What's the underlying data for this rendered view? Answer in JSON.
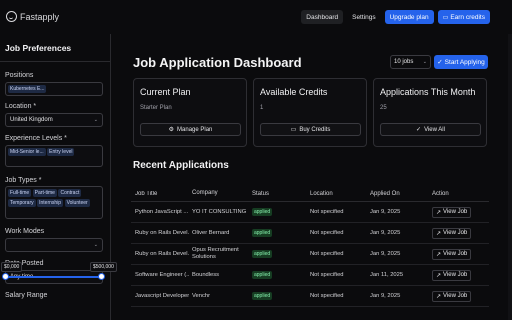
{
  "app": {
    "name": "Fastapply"
  },
  "nav": {
    "dashboard": "Dashboard",
    "settings": "Settings",
    "upgrade": "Upgrade plan",
    "earn": "Earn credits"
  },
  "sidebar": {
    "title": "Job Preferences",
    "positions": {
      "label": "Positions",
      "tags": [
        "Kubernetes E..."
      ]
    },
    "location": {
      "label": "Location *",
      "value": "United Kingdom"
    },
    "experience": {
      "label": "Experience Levels *",
      "tags": [
        "Mid-Senior le...",
        "Entry level"
      ]
    },
    "job_types": {
      "label": "Job Types *",
      "tags": [
        "Full-time",
        "Part-time",
        "Contract",
        "Temporary",
        "Internship",
        "Volunteer"
      ]
    },
    "work_modes": {
      "label": "Work Modes",
      "value": ""
    },
    "date_posted": {
      "label": "Date Posted",
      "value": "Any time"
    },
    "salary": {
      "label": "Salary Range",
      "min": "$0,000",
      "max": "$500,000",
      "min_frac": 0,
      "max_frac": 1
    }
  },
  "main": {
    "title": "Job Application Dashboard",
    "jobs_select": "10 jobs",
    "start_button": "Start Applying",
    "cards": [
      {
        "title": "Current Plan",
        "value": "Starter Plan",
        "button": "Manage Plan",
        "icon": "gear-icon"
      },
      {
        "title": "Available Credits",
        "value": "1",
        "button": "Buy Credits",
        "icon": "card-icon"
      },
      {
        "title": "Applications This Month",
        "value": "25",
        "button": "View All",
        "icon": "checkmark-icon"
      }
    ],
    "recent_title": "Recent Applications",
    "table": {
      "headers": [
        "Job Title",
        "Company",
        "Status",
        "Location",
        "Applied On",
        "Action"
      ],
      "rows": [
        {
          "title": "Python JavaScript ...",
          "company": "YO IT CONSULTING",
          "status": "applied",
          "location": "Not specified",
          "applied_on": "Jan 9, 2025",
          "action": "View Job"
        },
        {
          "title": "Ruby on Rails Devel...",
          "company": "Oliver Bernard",
          "status": "applied",
          "location": "Not specified",
          "applied_on": "Jan 9, 2025",
          "action": "View Job"
        },
        {
          "title": "Ruby on Rails Devel...",
          "company": "Opus Recruitment Solutions",
          "status": "applied",
          "location": "Not specified",
          "applied_on": "Jan 9, 2025",
          "action": "View Job"
        },
        {
          "title": "Software Engineer (...",
          "company": "Boundless",
          "status": "applied",
          "location": "Not specified",
          "applied_on": "Jan 11, 2025",
          "action": "View Job"
        },
        {
          "title": "Javascript Developer",
          "company": "Venchr",
          "status": "applied",
          "location": "Not specified",
          "applied_on": "Jan 9, 2025",
          "action": "View Job"
        }
      ]
    }
  },
  "colors": {
    "accent": "#2563eb",
    "background": "#0b0b0d",
    "badge": "#163d22"
  }
}
